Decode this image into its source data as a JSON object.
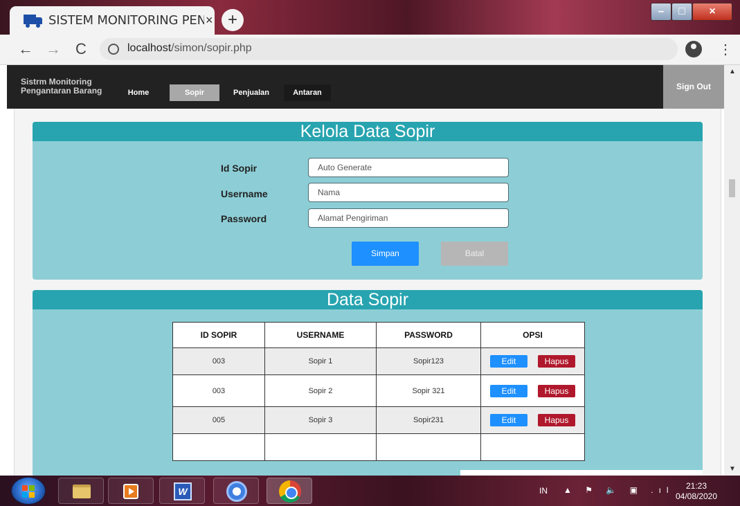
{
  "browser": {
    "tab_title": "SISTEM MONITORING PEN",
    "tab_close": "×",
    "new_tab": "+",
    "url_host": "localhost",
    "url_path": "/simon/sopir.php",
    "back": "←",
    "forward": "→",
    "reload": "C",
    "menu": "⋮"
  },
  "window_controls": {
    "minimize": "–",
    "maximize": "□",
    "close": "×"
  },
  "app": {
    "brand_line1": "Sistrm Monitoring",
    "brand_line2": "Pengantaran Barang",
    "nav": {
      "home": "Home",
      "sopir": "Sopir",
      "penjualan": "Penjualan",
      "antaran": "Antaran"
    },
    "sign_out": "Sign Out",
    "active_nav": "Sopir"
  },
  "form": {
    "title": "Kelola Data Sopir",
    "id_label": "Id Sopir",
    "id_placeholder": "Auto Generate",
    "username_label": "Username",
    "username_placeholder": "Nama",
    "password_label": "Password",
    "password_placeholder": "Alamat Pengiriman",
    "save_button": "Simpan",
    "cancel_button": "Batal"
  },
  "table": {
    "title": "Data Sopir",
    "headers": [
      "ID SOPIR",
      "USERNAME",
      "PASSWORD",
      "OPSI"
    ],
    "rows": [
      {
        "id": "003",
        "username": "Sopir 1",
        "password": "Sopir123"
      },
      {
        "id": "003",
        "username": "Sopir 2",
        "password": "Sopir 321"
      },
      {
        "id": "005",
        "username": "Sopir 3",
        "password": "Sopir231"
      }
    ],
    "edit_label": "Edit",
    "delete_label": "Hapus"
  },
  "taskbar": {
    "language": "IN",
    "tray": "▲ ⚑ 🔈 ▣ .ıl",
    "time": "21:23",
    "date": "04/08/2020"
  },
  "colors": {
    "panel_bg": "#8dced6",
    "panel_header": "#27a4b0",
    "primary_button": "#1e90ff",
    "danger_button": "#b0182c",
    "navbar": "#222222"
  }
}
